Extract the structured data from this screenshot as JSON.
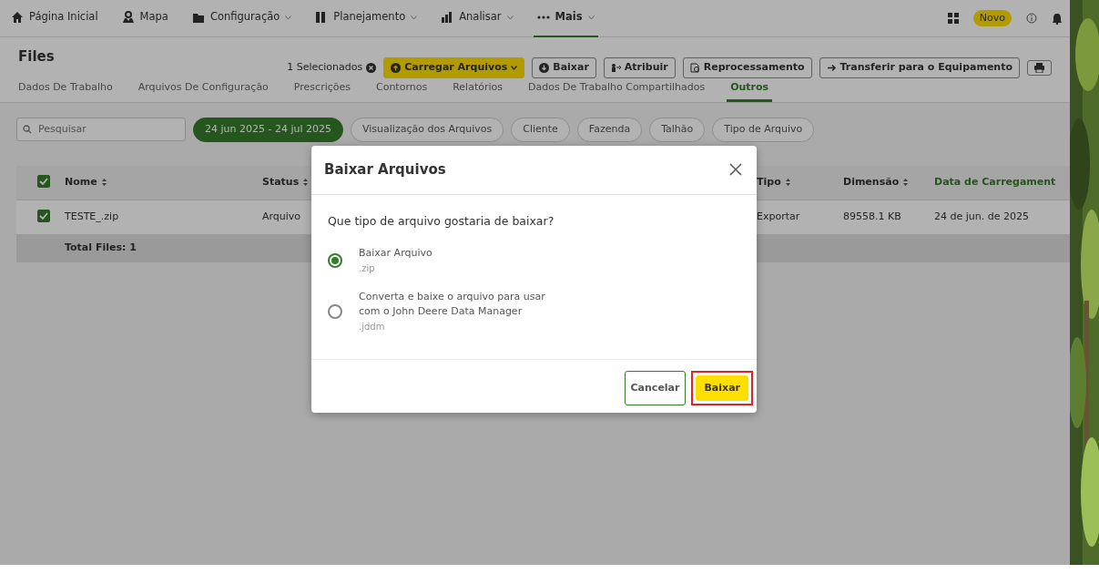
{
  "nav": {
    "items": [
      {
        "label": "Página Inicial",
        "dropdown": false,
        "selected": false
      },
      {
        "label": "Mapa",
        "dropdown": false,
        "selected": false
      },
      {
        "label": "Configuração",
        "dropdown": true,
        "selected": false
      },
      {
        "label": "Planejamento",
        "dropdown": true,
        "selected": false
      },
      {
        "label": "Analisar",
        "dropdown": true,
        "selected": false
      },
      {
        "label": "Mais",
        "dropdown": true,
        "selected": true
      }
    ],
    "new_badge": "Novo"
  },
  "page_title": "Files",
  "selection": {
    "count_label": "1 Selecionados"
  },
  "actions": [
    {
      "label": "Carregar Arquivos",
      "kind": "primary"
    },
    {
      "label": "Baixar",
      "kind": "outline"
    },
    {
      "label": "Atribuir",
      "kind": "outline"
    },
    {
      "label": "Reprocessamento",
      "kind": "outline"
    },
    {
      "label": "Transferir para o Equipamento",
      "kind": "outline"
    }
  ],
  "tabs": [
    {
      "label": "Dados De Trabalho",
      "selected": false
    },
    {
      "label": "Arquivos De Configuração",
      "selected": false
    },
    {
      "label": "Prescrições",
      "selected": false
    },
    {
      "label": "Contornos",
      "selected": false
    },
    {
      "label": "Relatórios",
      "selected": false
    },
    {
      "label": "Dados De Trabalho Compartilhados",
      "selected": false
    },
    {
      "label": "Outros",
      "selected": true
    }
  ],
  "search": {
    "placeholder": "Pesquisar"
  },
  "filters": [
    {
      "label": "24 jun 2025 - 24 jul 2025",
      "selected": true
    },
    {
      "label": "Visualização dos Arquivos",
      "selected": false
    },
    {
      "label": "Cliente",
      "selected": false
    },
    {
      "label": "Fazenda",
      "selected": false
    },
    {
      "label": "Talhão",
      "selected": false
    },
    {
      "label": "Tipo de Arquivo",
      "selected": false
    }
  ],
  "table": {
    "select_all_checked": true,
    "columns": [
      {
        "label": "Nome",
        "sorted": false
      },
      {
        "label": "Status",
        "sorted": false
      },
      {
        "label": "Tipo",
        "sorted": false
      },
      {
        "label": "Dimensão",
        "sorted": false
      },
      {
        "label": "Data de Carregament",
        "sorted": true
      }
    ],
    "rows": [
      {
        "checked": true,
        "cells": [
          "TESTE_.zip",
          "Arquivo",
          "Exportar",
          "89558.1 KB",
          "24 de jun. de 2025"
        ]
      }
    ],
    "footer": "Total Files: 1"
  },
  "modal": {
    "title": "Baixar Arquivos",
    "question": "Que tipo de arquivo gostaria de baixar?",
    "options": [
      {
        "label": "Baixar Arquivo",
        "extension": ".zip",
        "selected": true
      },
      {
        "label": "Converta e baixe o arquivo para usar com o John Deere Data Manager",
        "extension": ".jddm",
        "selected": false
      }
    ],
    "buttons": [
      {
        "label": "Cancelar",
        "kind": "secondary",
        "highlighted": false
      },
      {
        "label": "Baixar",
        "kind": "primary",
        "highlighted": true
      }
    ]
  }
}
